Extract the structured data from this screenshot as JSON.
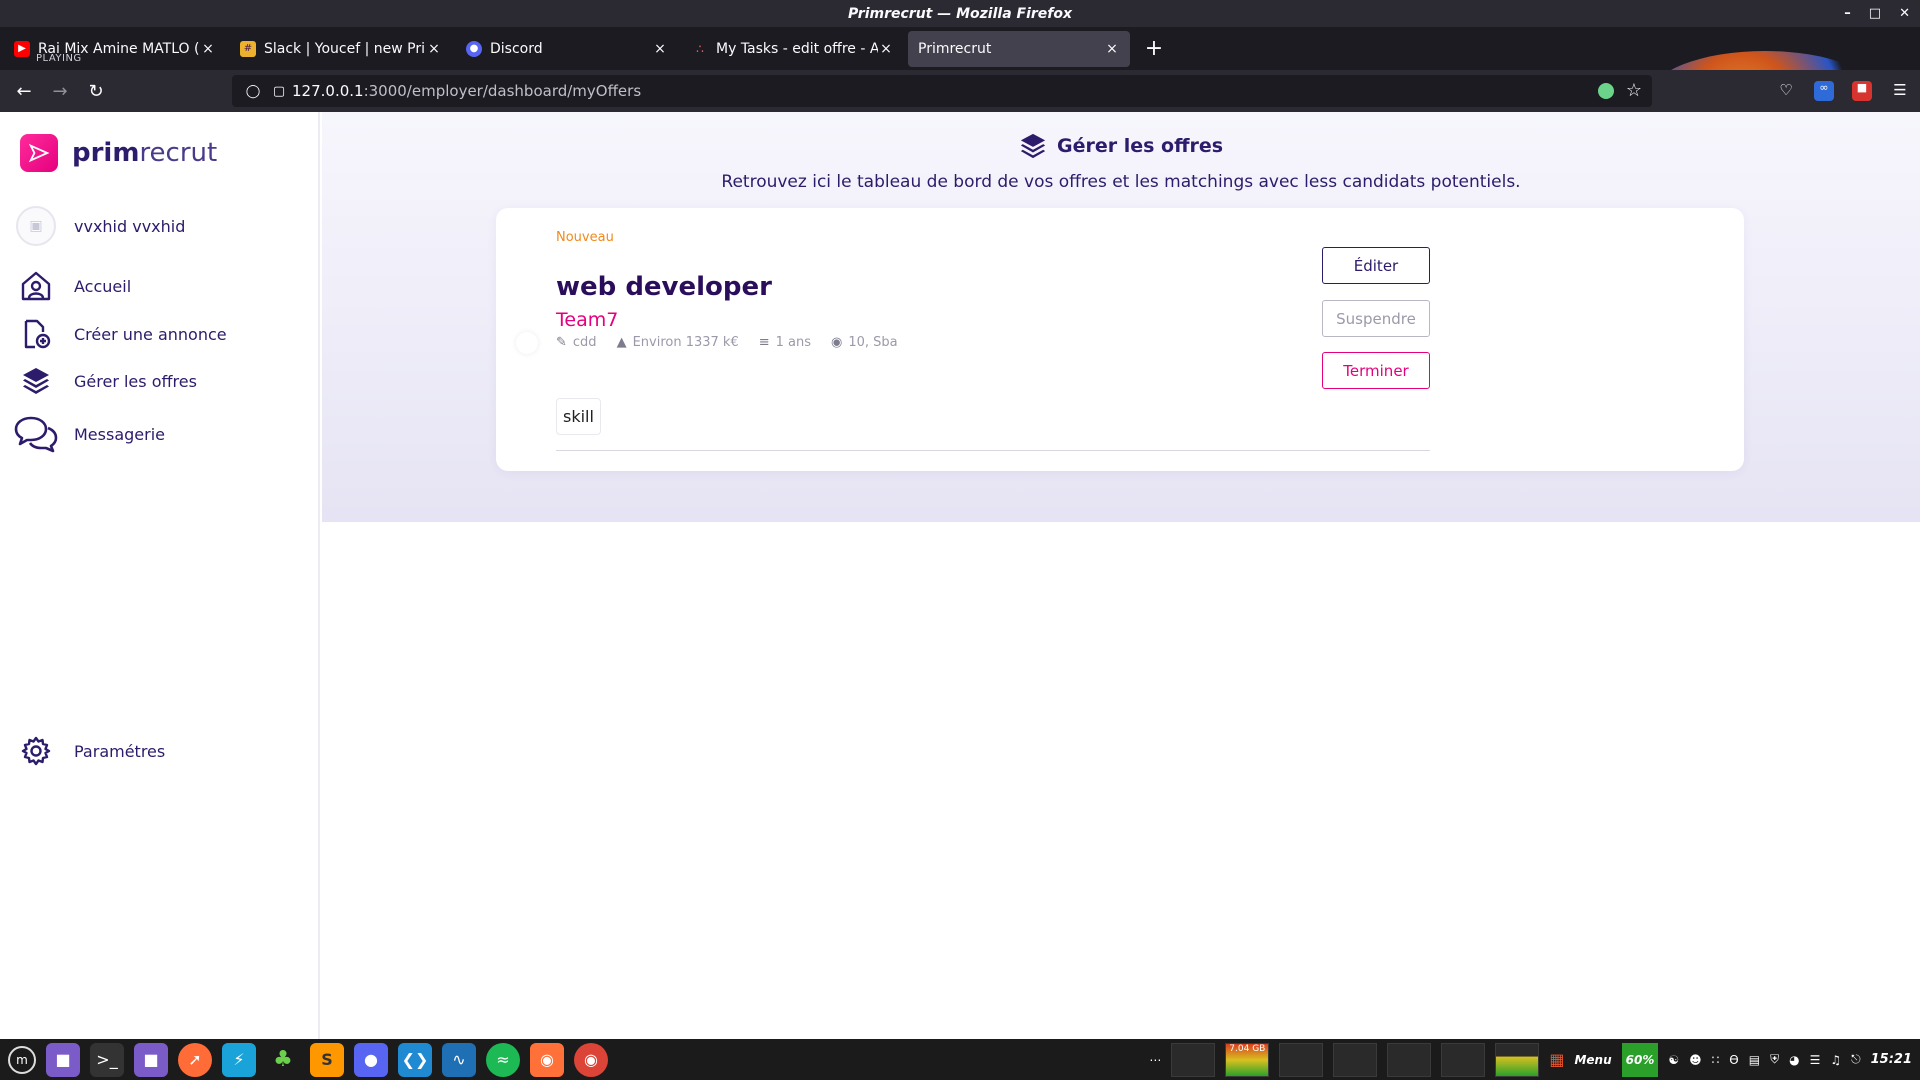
{
  "window": {
    "title": "Primrecrut — Mozilla Firefox"
  },
  "tabs": [
    {
      "title": "Rai Mix Amine MATLO ( Cl",
      "sub": "PLAYING",
      "icon": "youtube-icon",
      "active": false
    },
    {
      "title": "Slack | Youcef | new Prim",
      "icon": "slack-icon",
      "active": false
    },
    {
      "title": "Discord",
      "icon": "discord-icon",
      "active": false
    },
    {
      "title": "My Tasks - edit offre - As",
      "icon": "asana-icon",
      "active": false
    },
    {
      "title": "Primrecrut",
      "icon": "",
      "active": true
    }
  ],
  "urlbar": {
    "host": "127.0.0.1",
    "path": ":3000/employer/dashboard/myOffers"
  },
  "sidebar": {
    "logo_bold": "prim",
    "logo_light": "recrut",
    "user_name": "vvxhid vvxhid",
    "items": [
      {
        "label": "Accueil",
        "icon": "home-user-icon"
      },
      {
        "label": "Créer une annonce",
        "icon": "file-add-icon"
      },
      {
        "label": "Gérer les offres",
        "icon": "layers-icon"
      },
      {
        "label": "Messagerie",
        "icon": "chat-bubbles-icon"
      }
    ],
    "settings_label": "Paramétres"
  },
  "main": {
    "title": "Gérer les offres",
    "subtitle": "Retrouvez ici le tableau de bord de vos offres et les matchings avec less candidats potentiels."
  },
  "offer": {
    "badge": "Nouveau",
    "title": "web developer",
    "company": "Team7",
    "contract": "cdd",
    "salary": "Environ 1337 k€",
    "experience": "1 ans",
    "location": "10, Sba",
    "skill": "skill",
    "buttons": {
      "edit": "Éditer",
      "suspend": "Suspendre",
      "terminate": "Terminer"
    }
  },
  "taskbar": {
    "menu_label": "Menu",
    "battery": "60%",
    "clock": "15:21",
    "memory": "7.04 GB"
  },
  "colors": {
    "brand_primary": "#2d1b6b",
    "brand_accent": "#e5007e",
    "badge_new": "#f08a1d"
  }
}
